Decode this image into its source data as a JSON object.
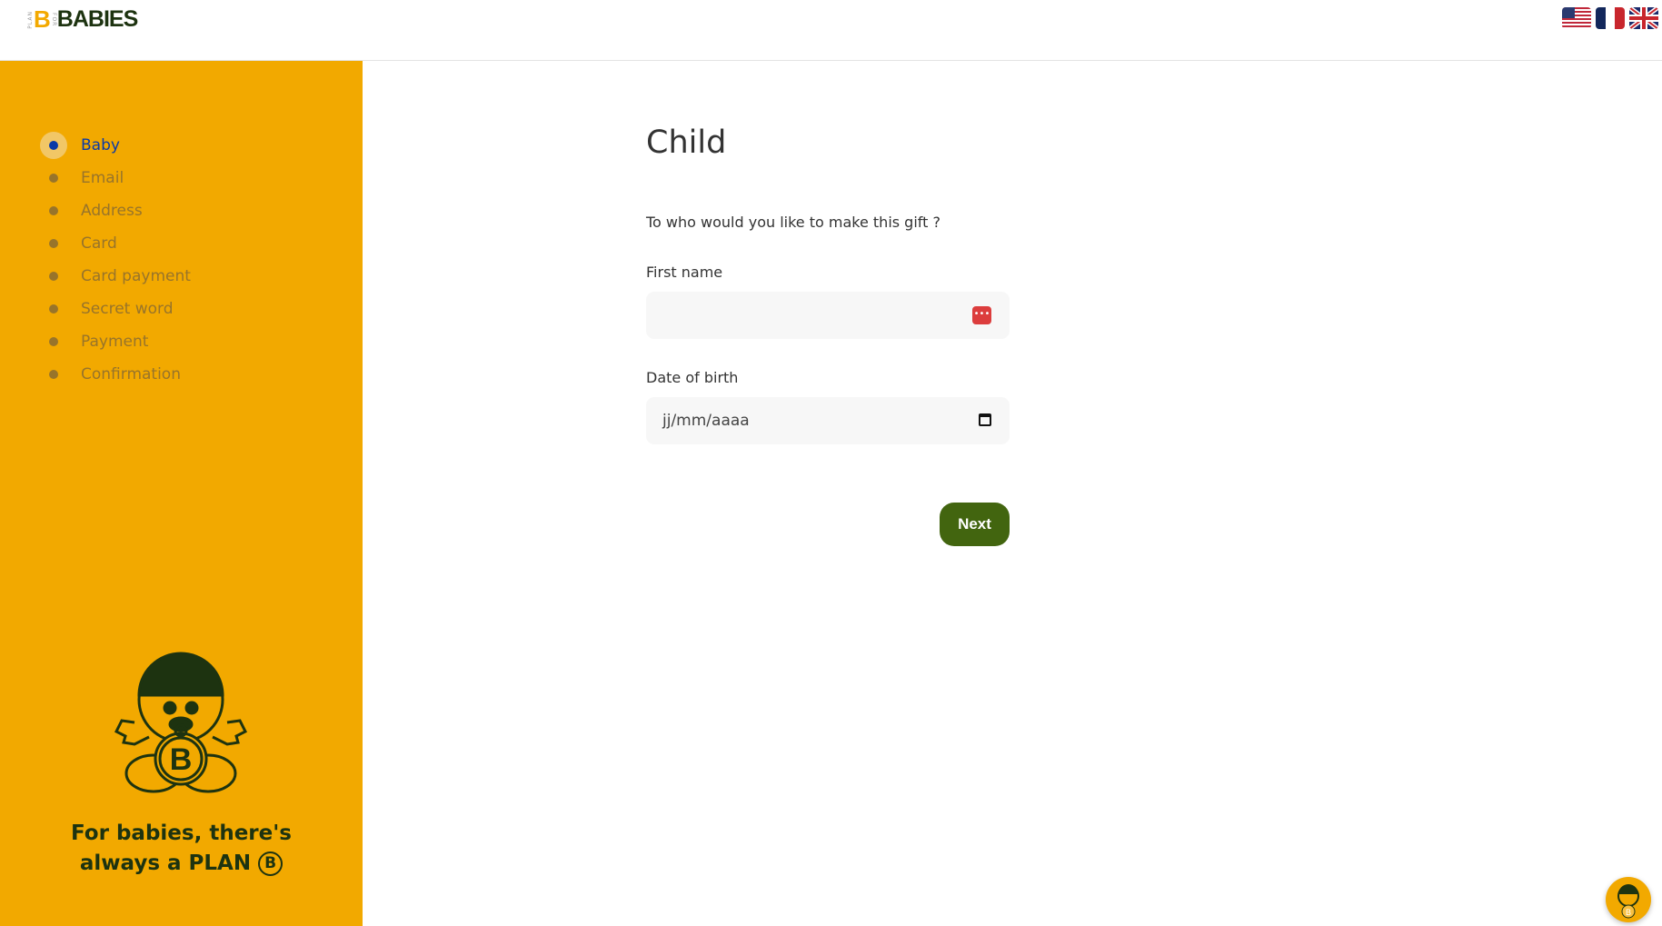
{
  "header": {
    "logo": {
      "plan": "PLAN",
      "b": "B",
      "for": "FOR",
      "word": "BABIES"
    },
    "languages": [
      {
        "code": "en-US",
        "icon": "us-flag-icon"
      },
      {
        "code": "fr",
        "icon": "france-flag-icon"
      },
      {
        "code": "en-GB",
        "icon": "uk-flag-icon"
      }
    ]
  },
  "sidebar": {
    "steps": [
      {
        "label": "Baby",
        "active": true
      },
      {
        "label": "Email"
      },
      {
        "label": "Address"
      },
      {
        "label": "Card"
      },
      {
        "label": "Card payment"
      },
      {
        "label": "Secret word"
      },
      {
        "label": "Payment"
      },
      {
        "label": "Confirmation"
      }
    ],
    "slogan_line1": "For babies, there's",
    "slogan_line2": "always a PLAN",
    "slogan_coin": "B"
  },
  "main": {
    "title": "Child",
    "subtitle": "To who would you like to make this gift ?",
    "first_name": {
      "label": "First name",
      "value": "",
      "placeholder": ""
    },
    "dob": {
      "label": "Date of birth",
      "placeholder": "jj/mm/aaaa"
    },
    "next_label": "Next"
  },
  "colors": {
    "sidebar": "#f2a900",
    "active": "#0a3aa8",
    "button": "#42650f",
    "dark": "#1d3310"
  }
}
